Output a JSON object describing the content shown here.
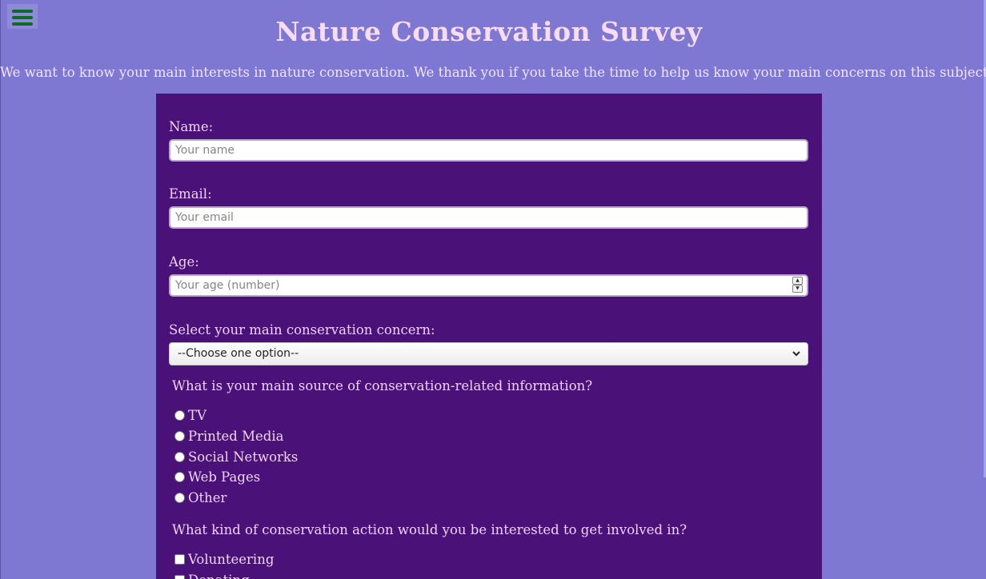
{
  "page": {
    "title": "Nature Conservation Survey",
    "intro": "We want to know your main interests in nature conservation. We thank you if you take the time to help us know your main concerns on this subject."
  },
  "menu": {
    "icon": "hamburger-menu-icon",
    "icon_color": "#0e6b22"
  },
  "colors": {
    "background": "#7e78d2",
    "form_background": "#4a1179",
    "text": "#f0d3f2"
  },
  "form": {
    "name": {
      "label": "Name:",
      "placeholder": "Your name",
      "value": ""
    },
    "email": {
      "label": "Email:",
      "placeholder": "Your email",
      "value": ""
    },
    "age": {
      "label": "Age:",
      "placeholder": "Your age (number)",
      "value": ""
    },
    "concern": {
      "label": "Select your main conservation concern:",
      "selected": "--Choose one option--"
    },
    "source": {
      "question": "What is your main source of conservation-related information?",
      "options": [
        "TV",
        "Printed Media",
        "Social Networks",
        "Web Pages",
        "Other"
      ]
    },
    "action": {
      "question": "What kind of conservation action would you be interested to get involved in?",
      "options": [
        "Volunteering",
        "Donating"
      ]
    }
  }
}
